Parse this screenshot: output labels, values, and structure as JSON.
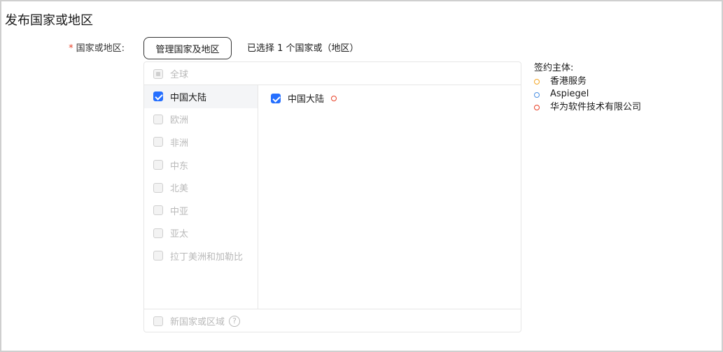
{
  "page": {
    "title": "发布国家或地区"
  },
  "field": {
    "required_mark": "*",
    "label": "国家或地区:"
  },
  "manage_button": {
    "label": "管理国家及地区"
  },
  "selected_summary": "已选择 1 个国家或（地区）",
  "panel": {
    "global": {
      "label": "全球",
      "state": "indeterminate"
    },
    "regions": [
      {
        "label": "中国大陆",
        "checked": true,
        "active": true,
        "disabled": false
      },
      {
        "label": "欧洲",
        "checked": false,
        "active": false,
        "disabled": true
      },
      {
        "label": "非洲",
        "checked": false,
        "active": false,
        "disabled": true
      },
      {
        "label": "中东",
        "checked": false,
        "active": false,
        "disabled": true
      },
      {
        "label": "北美",
        "checked": false,
        "active": false,
        "disabled": true
      },
      {
        "label": "中亚",
        "checked": false,
        "active": false,
        "disabled": true
      },
      {
        "label": "亚太",
        "checked": false,
        "active": false,
        "disabled": true
      },
      {
        "label": "拉丁美洲和加勒比",
        "checked": false,
        "active": false,
        "disabled": true
      }
    ],
    "countries": [
      {
        "label": "中国大陆",
        "checked": true,
        "entity_color": "#e84026"
      }
    ],
    "footer": {
      "label": "新国家或区域",
      "help_glyph": "?"
    }
  },
  "legend": {
    "title": "签约主体:",
    "items": [
      {
        "label": "香港服务",
        "color": "#f5a623"
      },
      {
        "label": "Aspiegel",
        "color": "#4a90e2"
      },
      {
        "label": "华为软件技术有限公司",
        "color": "#e84026"
      }
    ]
  },
  "colors": {
    "accent": "#256fff",
    "required": "#e84026"
  }
}
